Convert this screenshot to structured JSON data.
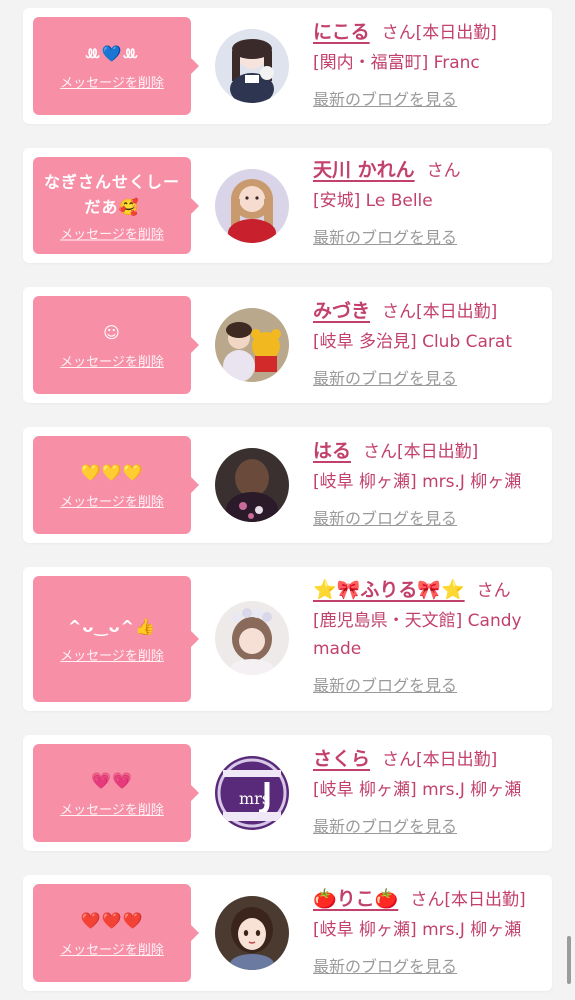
{
  "delete_label": "メッセージを削除",
  "blog_label": "最新のブログを見る",
  "san_label": "さん",
  "colors": {
    "bubble": "#f78fa7",
    "text_pink": "#c2416b",
    "link_gray": "#9a9a9a"
  },
  "items": [
    {
      "message": "ꔛ💙ꔛ",
      "name": "にこる",
      "status": "[本日出勤]",
      "shop": "[関内・福富町] Franc",
      "avatar": "girl-face-mask-icon"
    },
    {
      "message": "なぎさんせくしーだあ🥰",
      "name": "天川 かれん",
      "status": "",
      "shop": "[安城] Le Belle",
      "avatar": "blonde-girl-icon"
    },
    {
      "message": "☺︎",
      "name": "みづき",
      "status": "[本日出勤]",
      "shop": "[岐阜 多治見] Club Carat",
      "avatar": "girl-with-bear-icon"
    },
    {
      "message": "💛💛💛",
      "name": "はる",
      "status": "[本日出勤]",
      "shop": "[岐阜 柳ヶ瀬] mrs.J 柳ヶ瀬",
      "avatar": "girl-back-view-icon"
    },
    {
      "message": "^ᴗ‿ᴗ^👍",
      "name": "⭐🎀ふりる🎀⭐",
      "status": "",
      "shop": "[鹿児島県・天文館] Candy made",
      "avatar": "girl-flower-crown-icon"
    },
    {
      "message": "💗💗",
      "name": "さくら",
      "status": "[本日出勤]",
      "shop": "[岐阜 柳ヶ瀬] mrs.J 柳ヶ瀬",
      "avatar": "mrs-j-logo-icon"
    },
    {
      "message": "❤️❤️❤️",
      "name": "🍅りこ🍅",
      "status": "[本日出勤]",
      "shop": "[岐阜 柳ヶ瀬] mrs.J 柳ヶ瀬",
      "avatar": "anime-girl-icon"
    }
  ]
}
